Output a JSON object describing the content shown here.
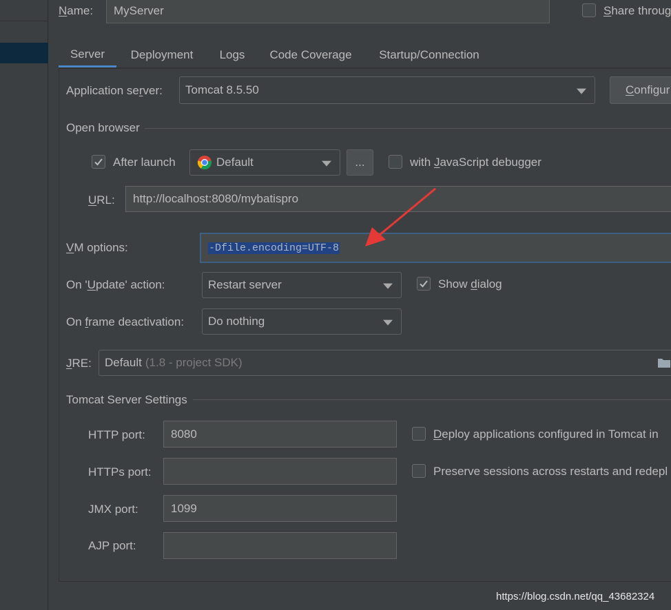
{
  "header": {
    "name_label": "Name:",
    "name_value": "MyServer",
    "share_label": "Share throug"
  },
  "tabs": [
    {
      "label": "Server",
      "active": true
    },
    {
      "label": "Deployment",
      "active": false
    },
    {
      "label": "Logs",
      "active": false
    },
    {
      "label": "Code Coverage",
      "active": false
    },
    {
      "label": "Startup/Connection",
      "active": false
    }
  ],
  "app_server": {
    "label": "Application server:",
    "value": "Tomcat 8.5.50",
    "configure_label": "Configur"
  },
  "open_browser": {
    "title": "Open browser",
    "after_launch_label": "After launch",
    "after_launch_checked": true,
    "browser_value": "Default",
    "browse_button": "...",
    "js_debugger_label": "with JavaScript debugger",
    "js_debugger_checked": false,
    "url_label": "URL:",
    "url_value": "http://localhost:8080/mybatispro"
  },
  "vm_options": {
    "label": "VM options:",
    "value": "-Dfile.encoding=UTF-8"
  },
  "on_update": {
    "label": "On 'Update' action:",
    "value": "Restart server",
    "show_dialog_label": "Show dialog",
    "show_dialog_checked": true
  },
  "on_frame": {
    "label": "On frame deactivation:",
    "value": "Do nothing"
  },
  "jre": {
    "label": "JRE:",
    "value": "Default",
    "hint": "(1.8 - project SDK)"
  },
  "tomcat_settings": {
    "title": "Tomcat Server Settings",
    "http_label": "HTTP port:",
    "http_value": "8080",
    "https_label": "HTTPs port:",
    "https_value": "",
    "jmx_label": "JMX port:",
    "jmx_value": "1099",
    "ajp_label": "AJP port:",
    "ajp_value": "",
    "deploy_label": "Deploy applications configured in Tomcat in",
    "deploy_checked": false,
    "preserve_label": "Preserve sessions across restarts and redepl",
    "preserve_checked": false
  },
  "watermark": "https://blog.csdn.net/qq_43682324",
  "colors": {
    "background": "#3c3f41",
    "input_bg": "#45494a",
    "tab_underline": "#4a88c7",
    "selection": "#214283",
    "annotation_arrow": "#e53935"
  }
}
